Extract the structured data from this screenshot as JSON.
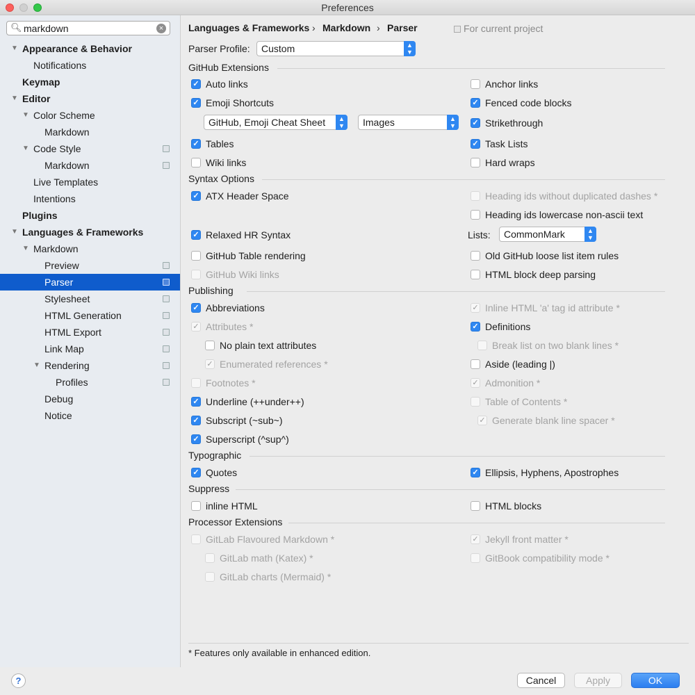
{
  "window": {
    "title": "Preferences"
  },
  "search": {
    "value": "markdown"
  },
  "tree": [
    {
      "label": "Appearance & Behavior",
      "bold": true,
      "arrow": true,
      "level": 0
    },
    {
      "label": "Notifications",
      "level": 1
    },
    {
      "label": "Keymap",
      "bold": true,
      "level": 0
    },
    {
      "label": "Editor",
      "bold": true,
      "arrow": true,
      "level": 0
    },
    {
      "label": "Color Scheme",
      "arrow": true,
      "level": 1
    },
    {
      "label": "Markdown",
      "level": 2
    },
    {
      "label": "Code Style",
      "arrow": true,
      "level": 1,
      "proj": true
    },
    {
      "label": "Markdown",
      "level": 2,
      "proj": true
    },
    {
      "label": "Live Templates",
      "level": 1
    },
    {
      "label": "Intentions",
      "level": 1
    },
    {
      "label": "Plugins",
      "bold": true,
      "level": 0
    },
    {
      "label": "Languages & Frameworks",
      "bold": true,
      "arrow": true,
      "level": 0
    },
    {
      "label": "Markdown",
      "arrow": true,
      "level": 1
    },
    {
      "label": "Preview",
      "level": 2,
      "proj": true
    },
    {
      "label": "Parser",
      "level": 2,
      "proj": true,
      "selected": true
    },
    {
      "label": "Stylesheet",
      "level": 2,
      "proj": true
    },
    {
      "label": "HTML Generation",
      "level": 2,
      "proj": true
    },
    {
      "label": "HTML Export",
      "level": 2,
      "proj": true
    },
    {
      "label": "Link Map",
      "level": 2,
      "proj": true
    },
    {
      "label": "Rendering",
      "arrow": true,
      "level": 2,
      "proj": true
    },
    {
      "label": "Profiles",
      "level": 3,
      "proj": true
    },
    {
      "label": "Debug",
      "level": 2
    },
    {
      "label": "Notice",
      "level": 2
    }
  ],
  "breadcrumb": {
    "c1": "Languages & Frameworks",
    "c2": "Markdown",
    "c3": "Parser",
    "sep": "›",
    "for_project": "For current project"
  },
  "parser_profile": {
    "label": "Parser Profile:",
    "value": "Custom"
  },
  "sections": {
    "github": "GitHub Extensions",
    "syntax": "Syntax Options",
    "publishing": "Publishing",
    "typographic": "Typographic",
    "suppress": "Suppress",
    "processor": "Processor Extensions"
  },
  "dropdowns": {
    "emoji_shortcuts": "GitHub, Emoji Cheat Sheet",
    "emoji_type": "Images",
    "lists_label": "Lists:",
    "lists_value": "CommonMark"
  },
  "checkboxes": {
    "auto_links": {
      "label": "Auto links",
      "checked": true
    },
    "anchor_links": {
      "label": "Anchor links",
      "checked": false
    },
    "emoji_shortcuts": {
      "label": "Emoji Shortcuts",
      "checked": true
    },
    "fenced_code": {
      "label": "Fenced code blocks",
      "checked": true
    },
    "strikethrough": {
      "label": "Strikethrough",
      "checked": true
    },
    "tables": {
      "label": "Tables",
      "checked": true
    },
    "task_lists": {
      "label": "Task Lists",
      "checked": true
    },
    "wiki_links": {
      "label": "Wiki links",
      "checked": false
    },
    "hard_wraps": {
      "label": "Hard wraps",
      "checked": false
    },
    "atx_header": {
      "label": "ATX Header Space",
      "checked": true
    },
    "heading_ids_dashes": {
      "label": "Heading ids without duplicated dashes *",
      "checked": false,
      "disabled": true
    },
    "heading_ids_lower": {
      "label": "Heading ids lowercase non-ascii text",
      "checked": false
    },
    "relaxed_hr": {
      "label": "Relaxed HR Syntax",
      "checked": true
    },
    "github_table": {
      "label": "GitHub Table rendering",
      "checked": false
    },
    "old_github_loose": {
      "label": "Old GitHub loose list item rules",
      "checked": false
    },
    "github_wiki": {
      "label": "GitHub Wiki links",
      "checked": false,
      "disabled": true
    },
    "html_deep": {
      "label": "HTML block deep parsing",
      "checked": false
    },
    "abbreviations": {
      "label": "Abbreviations",
      "checked": true
    },
    "inline_html_a": {
      "label": "Inline HTML 'a' tag id attribute *",
      "checked": true,
      "disabled": true
    },
    "attributes": {
      "label": "Attributes *",
      "checked": true,
      "disabled": true
    },
    "definitions": {
      "label": "Definitions",
      "checked": true
    },
    "no_plain_text": {
      "label": "No plain text attributes",
      "checked": false
    },
    "break_list": {
      "label": "Break list on two blank lines *",
      "checked": false,
      "disabled": true
    },
    "enumerated_refs": {
      "label": "Enumerated references *",
      "checked": true,
      "disabled": true
    },
    "aside": {
      "label": "Aside (leading |)",
      "checked": false
    },
    "footnotes": {
      "label": "Footnotes *",
      "checked": false,
      "disabled": true
    },
    "admonition": {
      "label": "Admonition *",
      "checked": true,
      "disabled": true
    },
    "underline": {
      "label": "Underline (++under++)",
      "checked": true
    },
    "toc": {
      "label": "Table of Contents *",
      "checked": false,
      "disabled": true
    },
    "subscript": {
      "label": "Subscript (~sub~)",
      "checked": true
    },
    "blank_line_spacer": {
      "label": "Generate blank line spacer *",
      "checked": true,
      "disabled": true
    },
    "superscript": {
      "label": "Superscript (^sup^)",
      "checked": true
    },
    "quotes": {
      "label": "Quotes",
      "checked": true
    },
    "ellipsis": {
      "label": "Ellipsis, Hyphens, Apostrophes",
      "checked": true
    },
    "inline_html": {
      "label": "inline HTML",
      "checked": false
    },
    "html_blocks": {
      "label": "HTML blocks",
      "checked": false
    },
    "gitlab_md": {
      "label": "GitLab Flavoured Markdown *",
      "checked": false,
      "disabled": true
    },
    "jekyll": {
      "label": "Jekyll front matter *",
      "checked": true,
      "disabled": true
    },
    "gitlab_math": {
      "label": "GitLab math (Katex) *",
      "checked": false,
      "disabled": true
    },
    "gitbook": {
      "label": "GitBook compatibility mode *",
      "checked": false,
      "disabled": true
    },
    "gitlab_charts": {
      "label": "GitLab charts (Mermaid) *",
      "checked": false,
      "disabled": true
    }
  },
  "footnote": "* Features only available in enhanced edition.",
  "buttons": {
    "help": "?",
    "cancel": "Cancel",
    "apply": "Apply",
    "ok": "OK"
  }
}
